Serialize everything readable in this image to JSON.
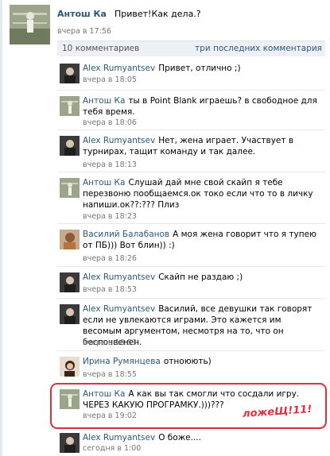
{
  "post": {
    "author": "Антош Ка",
    "message": "Привет!Как дела.?",
    "time": "вчера в 17:56"
  },
  "comments_bar": {
    "count": "10 комментариев",
    "last_three": "три последних комментария"
  },
  "comments": [
    {
      "author": "Alex Rumyantsev",
      "text": "Привет, отлично ;)",
      "time": "вчера в 18:05"
    },
    {
      "author": "Антош Ка",
      "text": "ты в Point Blank играешь? в свободное для тебя время.",
      "time": "вчера в 18:06"
    },
    {
      "author": "Alex Rumyantsev",
      "text": "Нет, жена играет. Участвует в турнирах, тащит команду и так далее.",
      "time": "вчера в 18:13"
    },
    {
      "author": "Антош Ка",
      "text": "Слушай дай мне свой скайп я тебе перезвоню пообщаемся.ок токо если что то в личку напиши.ок??:??? Плиз",
      "time": "вчера в 18:23"
    },
    {
      "author": "Василий Балабанов",
      "text": "А моя жена говорит что я тупею от ПБ))) Вот блин)) :)",
      "time": "вчера в 18:26"
    },
    {
      "author": "Alex Rumyantsev",
      "text": "Скайп не раздаю ;)",
      "time": "вчера в 18:53"
    },
    {
      "author": "Alex Rumyantsev",
      "text": "Василий, все девушки так говорят если не увлекаются играми. Это кажется им весомым аргументом, несмотря на то, что он беспочвенен.",
      "time": "вчера в 18:53"
    },
    {
      "author": "Ирина Румянцева",
      "text": "отноюють)",
      "time": "вчера в 18:55"
    },
    {
      "author": "Антош Ка",
      "text": "А как вы так смогли что сосдали игру. ЧЕРЕЗ КАКУЮ ПРОГРАМКУ.)))???",
      "time": "вчера в 19:02"
    },
    {
      "author": "Alex Rumyantsev",
      "text": "О боже....",
      "time": "сегодня в 1:00"
    }
  ],
  "annotation": "ложеЩ!11!",
  "colors": {
    "link": "#2b587a",
    "highlight": "#e0303a",
    "bar": "#edf1f5"
  }
}
